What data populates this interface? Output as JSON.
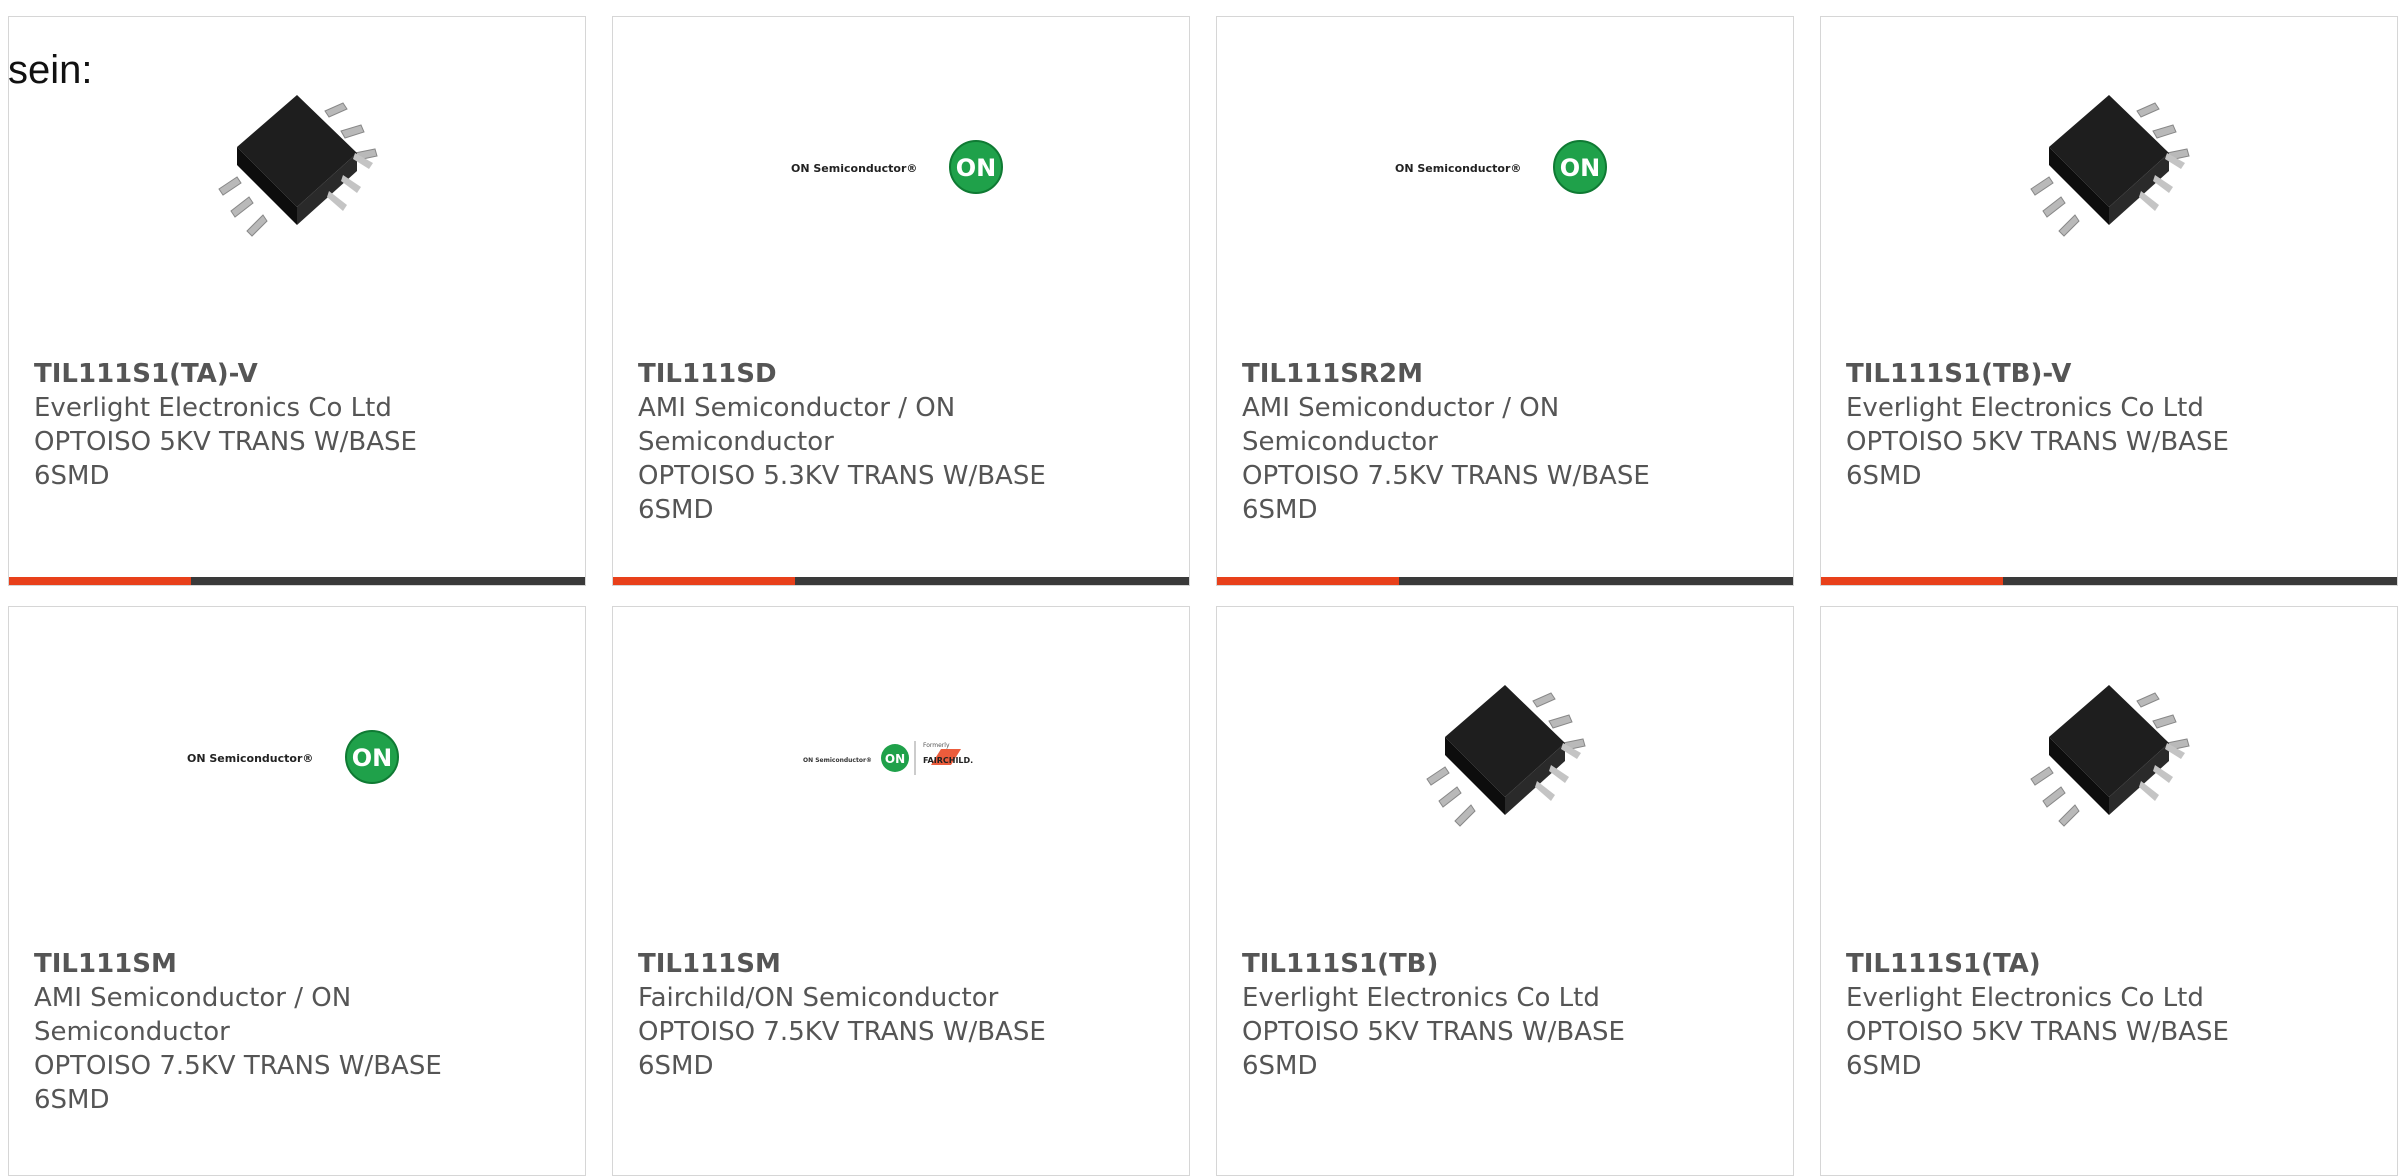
{
  "intro_text": "sein:",
  "colors": {
    "accent": "#e8401a",
    "bar": "#3a3a3a",
    "on_green": "#1fa14a"
  },
  "products": [
    {
      "name": "TIL111S1(TA)-V",
      "maker_lines": [
        "Everlight Electronics Co Ltd"
      ],
      "desc": "OPTOISO 5KV TRANS W/BASE",
      "pkg": "6SMD",
      "image": "chip"
    },
    {
      "name": "TIL111SD",
      "maker_lines": [
        "AMI Semiconductor / ON",
        "Semiconductor"
      ],
      "desc": "OPTOISO 5.3KV TRANS W/BASE",
      "pkg": "6SMD",
      "image": "on-logo"
    },
    {
      "name": "TIL111SR2M",
      "maker_lines": [
        "AMI Semiconductor / ON",
        "Semiconductor"
      ],
      "desc": "OPTOISO 7.5KV TRANS W/BASE",
      "pkg": "6SMD",
      "image": "on-logo"
    },
    {
      "name": "TIL111S1(TB)-V",
      "maker_lines": [
        "Everlight Electronics Co Ltd"
      ],
      "desc": "OPTOISO 5KV TRANS W/BASE",
      "pkg": "6SMD",
      "image": "chip"
    },
    {
      "name": "TIL111SM",
      "maker_lines": [
        "AMI Semiconductor / ON",
        "Semiconductor"
      ],
      "desc": "OPTOISO 7.5KV TRANS W/BASE",
      "pkg": "6SMD",
      "image": "on-logo"
    },
    {
      "name": "TIL111SM",
      "maker_lines": [
        "Fairchild/ON Semiconductor"
      ],
      "desc": "OPTOISO 7.5KV TRANS W/BASE",
      "pkg": "6SMD",
      "image": "on-fairchild-logo"
    },
    {
      "name": "TIL111S1(TB)",
      "maker_lines": [
        "Everlight Electronics Co Ltd"
      ],
      "desc": "OPTOISO 5KV TRANS W/BASE",
      "pkg": "6SMD",
      "image": "chip"
    },
    {
      "name": "TIL111S1(TA)",
      "maker_lines": [
        "Everlight Electronics Co Ltd"
      ],
      "desc": "OPTOISO 5KV TRANS W/BASE",
      "pkg": "6SMD",
      "image": "chip"
    }
  ],
  "logos": {
    "on_text": "ON Semiconductor®",
    "on_badge": "ON",
    "fairchild_formerly": "Formerly",
    "fairchild_text": "FAIRCHILD."
  }
}
